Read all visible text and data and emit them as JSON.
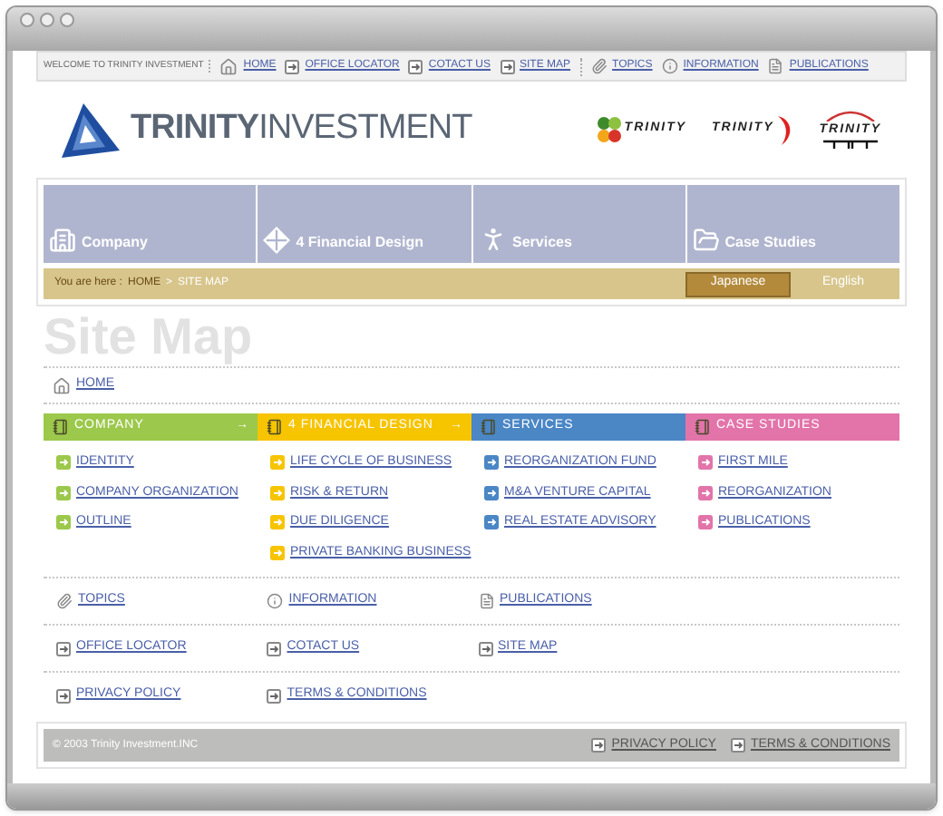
{
  "top_nav": {
    "welcome": "WELCOME TO TRINITY INVESTMENT",
    "links": [
      {
        "label": "HOME",
        "kind": "home"
      },
      {
        "label": "OFFICE LOCATOR",
        "kind": "arrow"
      },
      {
        "label": "COTACT US",
        "kind": "arrow"
      },
      {
        "label": "SITE MAP",
        "kind": "arrow"
      }
    ],
    "links_2": [
      {
        "label": "TOPICS",
        "kind": "clip"
      },
      {
        "label": "INFORMATION",
        "kind": "info"
      },
      {
        "label": "PUBLICATIONS",
        "kind": "doc"
      }
    ]
  },
  "header": {
    "brand_bold": "TRINITY",
    "brand_light": "INVESTMENT",
    "partner_logos": [
      {
        "label": "TRINITY",
        "kind": "clover"
      },
      {
        "label": "TRINITY",
        "kind": "swoosh"
      },
      {
        "label": "TRINITY",
        "kind": "arch"
      }
    ]
  },
  "main_nav": [
    {
      "label": "Company",
      "kind": "building"
    },
    {
      "label": "4 Financial Design",
      "kind": "diamond"
    },
    {
      "label": "Services",
      "kind": "figure"
    },
    {
      "label": "Case Studies",
      "kind": "folder"
    }
  ],
  "breadcrumb": {
    "prefix": "You are here :",
    "items": [
      "HOME",
      "SITE MAP"
    ],
    "separator": ">"
  },
  "languages": [
    {
      "label": "Japanese",
      "selected": true
    },
    {
      "label": "English",
      "selected": false
    }
  ],
  "heading": "Site Map",
  "home_link": "HOME",
  "categories": [
    {
      "title": "COMPANY",
      "color": "#9cc84b",
      "arrow": "→",
      "links": [
        "IDENTITY",
        "COMPANY ORGANIZATION",
        "OUTLINE"
      ]
    },
    {
      "title": "4 FINANCIAL DESIGN",
      "color": "#f7c400",
      "arrow": "→",
      "links": [
        "LIFE CYCLE OF BUSINESS",
        "RISK & RETURN",
        "DUE DILIGENCE",
        "PRIVATE BANKING BUSINESS"
      ]
    },
    {
      "title": "SERVICES",
      "color": "#4b86c5",
      "links": [
        "REORGANIZATION FUND",
        "M&A VENTURE CAPITAL",
        "REAL ESTATE ADVISORY"
      ]
    },
    {
      "title": "CASE STUDIES",
      "color": "#e274aa",
      "links": [
        "FIRST MILE",
        "REORGANIZATION",
        "PUBLICATIONS"
      ]
    }
  ],
  "misc_rows": [
    [
      {
        "label": "TOPICS",
        "kind": "clip"
      },
      {
        "label": "INFORMATION",
        "kind": "info"
      },
      {
        "label": "PUBLICATIONS",
        "kind": "doc"
      }
    ],
    [
      {
        "label": "OFFICE LOCATOR",
        "kind": "arrow"
      },
      {
        "label": "COTACT US",
        "kind": "arrow"
      },
      {
        "label": "SITE MAP",
        "kind": "arrow"
      }
    ],
    [
      {
        "label": "PRIVACY POLICY",
        "kind": "arrow"
      },
      {
        "label": "TERMS & CONDITIONS",
        "kind": "arrow"
      }
    ]
  ],
  "footer": {
    "copyright": "© 2003 Trinity Investment.INC",
    "links": [
      "PRIVACY POLICY",
      "TERMS & CONDITIONS"
    ]
  }
}
